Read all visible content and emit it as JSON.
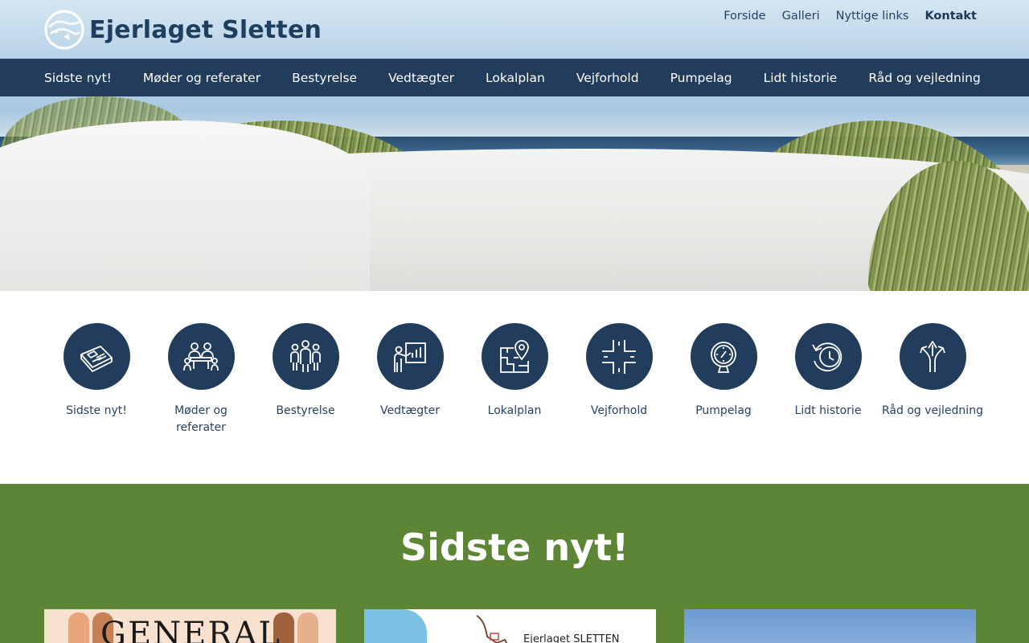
{
  "site": {
    "name": "Ejerlaget Sletten"
  },
  "topnav": [
    {
      "label": "Forside"
    },
    {
      "label": "Galleri"
    },
    {
      "label": "Nyttige links"
    },
    {
      "label": "Kontakt"
    }
  ],
  "mainnav": [
    {
      "label": "Sidste nyt!"
    },
    {
      "label": "Møder og referater"
    },
    {
      "label": "Bestyrelse"
    },
    {
      "label": "Vedtægter"
    },
    {
      "label": "Lokalplan"
    },
    {
      "label": "Vejforhold"
    },
    {
      "label": "Pumpelag"
    },
    {
      "label": "Lidt historie"
    },
    {
      "label": "Råd og vejledning"
    }
  ],
  "quicklinks": [
    {
      "label": "Sidste nyt!",
      "icon": "newspaper-icon"
    },
    {
      "label": "Møder og referater",
      "icon": "meeting-icon"
    },
    {
      "label": "Bestyrelse",
      "icon": "group-icon"
    },
    {
      "label": "Vedtægter",
      "icon": "presentation-icon"
    },
    {
      "label": "Lokalplan",
      "icon": "map-pin-icon"
    },
    {
      "label": "Vejforhold",
      "icon": "crossroads-icon"
    },
    {
      "label": "Pumpelag",
      "icon": "gauge-icon"
    },
    {
      "label": "Lidt historie",
      "icon": "history-icon"
    },
    {
      "label": "Råd og vejledning",
      "icon": "directions-icon"
    }
  ],
  "news": {
    "title": "Sidste nyt!",
    "cards": [
      {
        "text": "GENERAL"
      },
      {
        "text": "Ejerlaget SLETTEN"
      },
      {
        "text": ""
      }
    ]
  },
  "colors": {
    "navy": "#213d5b",
    "green": "#5c8535",
    "white": "#ffffff"
  }
}
